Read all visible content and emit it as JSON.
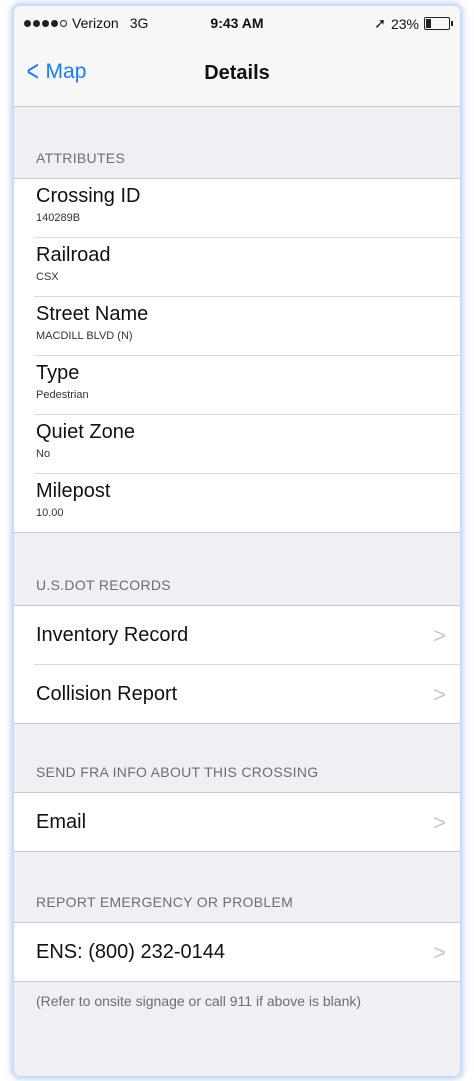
{
  "status": {
    "carrier": "Verizon",
    "network": "3G",
    "time": "9:43 AM",
    "battery": "23%",
    "battery_level": 0.23
  },
  "nav": {
    "back_label": "Map",
    "title": "Details"
  },
  "attributes": {
    "header": "ATTRIBUTES",
    "items": [
      {
        "label": "Crossing ID",
        "value": "140289B"
      },
      {
        "label": "Railroad",
        "value": "CSX"
      },
      {
        "label": "Street Name",
        "value": "MACDILL BLVD (N)"
      },
      {
        "label": "Type",
        "value": "Pedestrian"
      },
      {
        "label": "Quiet Zone",
        "value": "No"
      },
      {
        "label": "Milepost",
        "value": "10.00"
      }
    ]
  },
  "dot_records": {
    "header": "U.S.DOT RECORDS",
    "items": [
      {
        "label": "Inventory Record"
      },
      {
        "label": "Collision Report"
      }
    ]
  },
  "send_info": {
    "header": "SEND FRA INFO ABOUT THIS CROSSING",
    "items": [
      {
        "label": "Email"
      }
    ]
  },
  "report": {
    "header": "REPORT EMERGENCY OR PROBLEM",
    "items": [
      {
        "label": "ENS: (800) 232-0144"
      }
    ],
    "note": "(Refer to onsite signage or call 911 if above is blank)"
  },
  "colors": {
    "accent": "#1a7cf5",
    "background": "#efeff4",
    "header_text": "#6d6d72"
  }
}
